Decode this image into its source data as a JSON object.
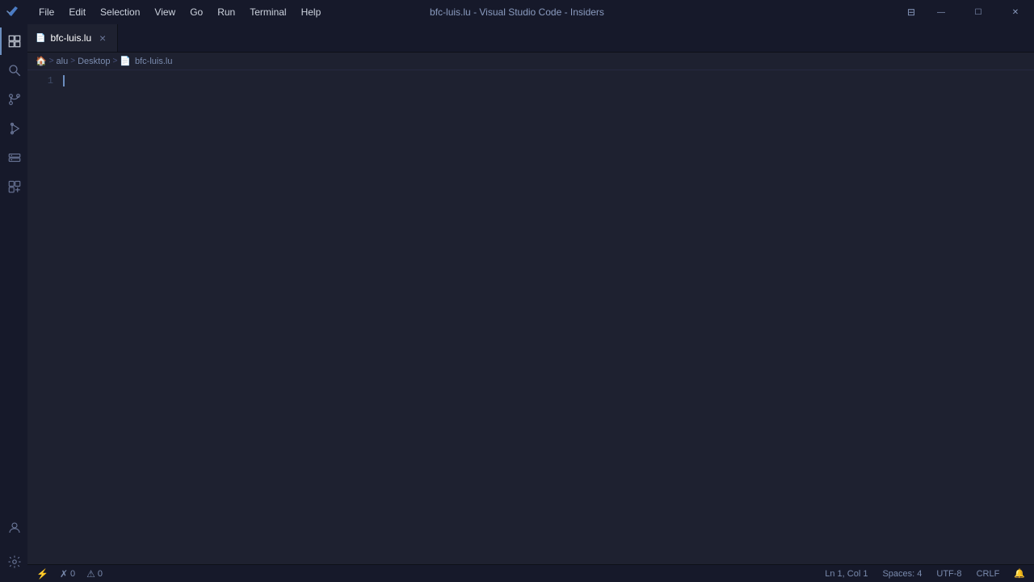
{
  "titlebar": {
    "title": "bfc-luis.lu - Visual Studio Code - Insiders",
    "menu": [
      "File",
      "Edit",
      "Selection",
      "View",
      "Go",
      "Run",
      "Terminal",
      "Help"
    ]
  },
  "tabs": [
    {
      "label": "bfc-luis.lu",
      "active": true,
      "icon": "📄"
    }
  ],
  "breadcrumb": {
    "items": [
      "home",
      "alu",
      "Desktop",
      "bfc-luis.lu"
    ]
  },
  "editor": {
    "line1": "1"
  },
  "statusbar": {
    "left": {
      "remote": "",
      "errors": "0",
      "warnings": "0"
    },
    "right": {
      "position": "Ln 1, Col 1",
      "spaces": "Spaces: 4",
      "encoding": "UTF-8",
      "eol": "CRLF",
      "language": ""
    }
  },
  "activity": {
    "items": [
      "explorer",
      "search",
      "source-control",
      "run-debug",
      "remote-explorer",
      "extensions",
      "accounts",
      "triangle-alert",
      "book",
      "image"
    ]
  }
}
